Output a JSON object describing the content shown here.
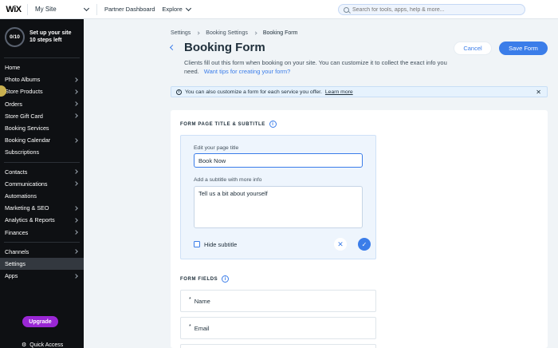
{
  "topbar": {
    "logo": "WiX",
    "site_name": "My Site",
    "partner_dashboard": "Partner Dashboard",
    "explore": "Explore",
    "search_placeholder": "Search for tools, apps, help & more..."
  },
  "sidebar": {
    "setup_progress": "0/10",
    "setup_title": "Set up your site",
    "setup_subtitle": "10 steps left",
    "groups": [
      [
        {
          "label": "Home",
          "chevron": false
        },
        {
          "label": "Photo Albums",
          "chevron": true
        },
        {
          "label": "Store Products",
          "chevron": true
        },
        {
          "label": "Orders",
          "chevron": true
        },
        {
          "label": "Store Gift Card",
          "chevron": true
        },
        {
          "label": "Booking Services",
          "chevron": false
        },
        {
          "label": "Booking Calendar",
          "chevron": true
        },
        {
          "label": "Subscriptions",
          "chevron": false
        }
      ],
      [
        {
          "label": "Contacts",
          "chevron": true
        },
        {
          "label": "Communications",
          "chevron": true
        },
        {
          "label": "Automations",
          "chevron": false
        },
        {
          "label": "Marketing & SEO",
          "chevron": true
        },
        {
          "label": "Analytics & Reports",
          "chevron": true
        },
        {
          "label": "Finances",
          "chevron": true
        }
      ],
      [
        {
          "label": "Channels",
          "chevron": true
        },
        {
          "label": "Settings",
          "chevron": false,
          "active": true
        },
        {
          "label": "Apps",
          "chevron": true
        }
      ]
    ],
    "upgrade": "Upgrade",
    "quick_access": "Quick Access"
  },
  "breadcrumb": [
    "Settings",
    "Booking Settings",
    "Booking Form"
  ],
  "page": {
    "title": "Booking Form",
    "description": "Clients fill out this form when booking on your site. You can customize it to collect the exact info you need.",
    "tips_link": "Want tips for creating your form?",
    "cancel": "Cancel",
    "save": "Save Form"
  },
  "info_bar": {
    "text": "You can also customize a form for each service you offer.",
    "link": "Learn more"
  },
  "form": {
    "section_title": "FORM PAGE TITLE & SUBTITLE",
    "title_label": "Edit your page title",
    "title_value": "Book Now",
    "subtitle_label": "Add a subtitle with more info",
    "subtitle_value": "Tell us a bit about yourself",
    "hide_subtitle": "Hide subtitle",
    "fields_title": "FORM FIELDS",
    "fields": [
      "Name",
      "Email"
    ]
  },
  "colors": {
    "accent": "#3b7de9",
    "sidebar_bg": "#0e1013",
    "upgrade": "#9a27d5"
  }
}
